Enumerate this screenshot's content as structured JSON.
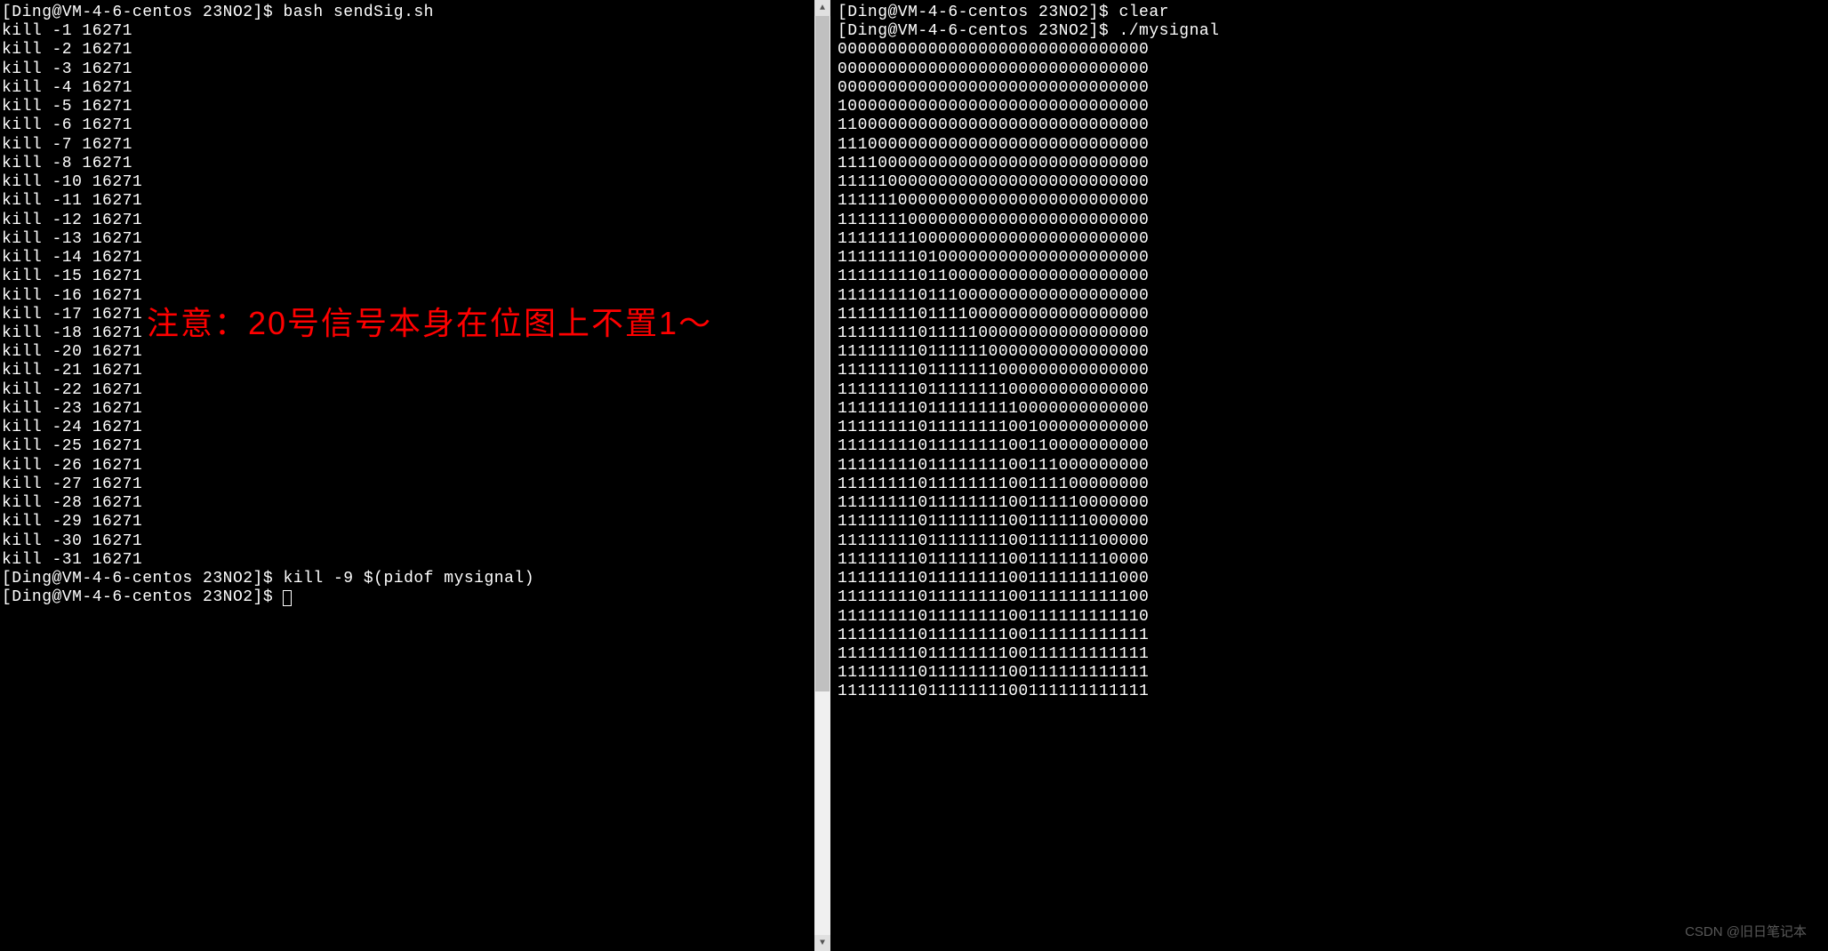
{
  "left_terminal": {
    "prompt1": "[Ding@VM-4-6-centos 23NO2]$ ",
    "cmd1": "bash sendSig.sh",
    "kill_lines": [
      "kill -1 16271",
      "kill -2 16271",
      "kill -3 16271",
      "kill -4 16271",
      "kill -5 16271",
      "kill -6 16271",
      "kill -7 16271",
      "kill -8 16271",
      "kill -10 16271",
      "kill -11 16271",
      "kill -12 16271",
      "kill -13 16271",
      "kill -14 16271",
      "kill -15 16271",
      "kill -16 16271",
      "kill -17 16271",
      "kill -18 16271",
      "kill -20 16271",
      "kill -21 16271",
      "kill -22 16271",
      "kill -23 16271",
      "kill -24 16271",
      "kill -25 16271",
      "kill -26 16271",
      "kill -27 16271",
      "kill -28 16271",
      "kill -29 16271",
      "kill -30 16271",
      "kill -31 16271"
    ],
    "prompt2": "[Ding@VM-4-6-centos 23NO2]$ ",
    "cmd2": "kill -9 $(pidof mysignal)",
    "prompt3": "[Ding@VM-4-6-centos 23NO2]$ "
  },
  "right_terminal": {
    "prompt1": "[Ding@VM-4-6-centos 23NO2]$ ",
    "cmd1": "clear",
    "prompt2": "[Ding@VM-4-6-centos 23NO2]$ ",
    "cmd2": "./mysignal",
    "output_lines": [
      "0000000000000000000000000000000",
      "0000000000000000000000000000000",
      "0000000000000000000000000000000",
      "1000000000000000000000000000000",
      "1100000000000000000000000000000",
      "1110000000000000000000000000000",
      "1111000000000000000000000000000",
      "1111100000000000000000000000000",
      "1111110000000000000000000000000",
      "1111111000000000000000000000000",
      "1111111100000000000000000000000",
      "1111111101000000000000000000000",
      "1111111101100000000000000000000",
      "1111111101110000000000000000000",
      "1111111101111000000000000000000",
      "1111111101111100000000000000000",
      "1111111101111110000000000000000",
      "1111111101111111000000000000000",
      "1111111101111111100000000000000",
      "1111111101111111110000000000000",
      "1111111101111111100100000000000",
      "1111111101111111100110000000000",
      "1111111101111111100111000000000",
      "1111111101111111100111100000000",
      "1111111101111111100111110000000",
      "1111111101111111100111111000000",
      "1111111101111111100111111100000",
      "1111111101111111100111111110000",
      "1111111101111111100111111111000",
      "1111111101111111100111111111100",
      "1111111101111111100111111111110",
      "1111111101111111100111111111111",
      "1111111101111111100111111111111",
      "1111111101111111100111111111111",
      "1111111101111111100111111111111"
    ]
  },
  "annotation_text": "注意：20号信号本身在位图上不置1～",
  "watermark_text": "CSDN @旧日笔记本",
  "scroll_glyphs": {
    "up": "▲",
    "down": "▼"
  }
}
